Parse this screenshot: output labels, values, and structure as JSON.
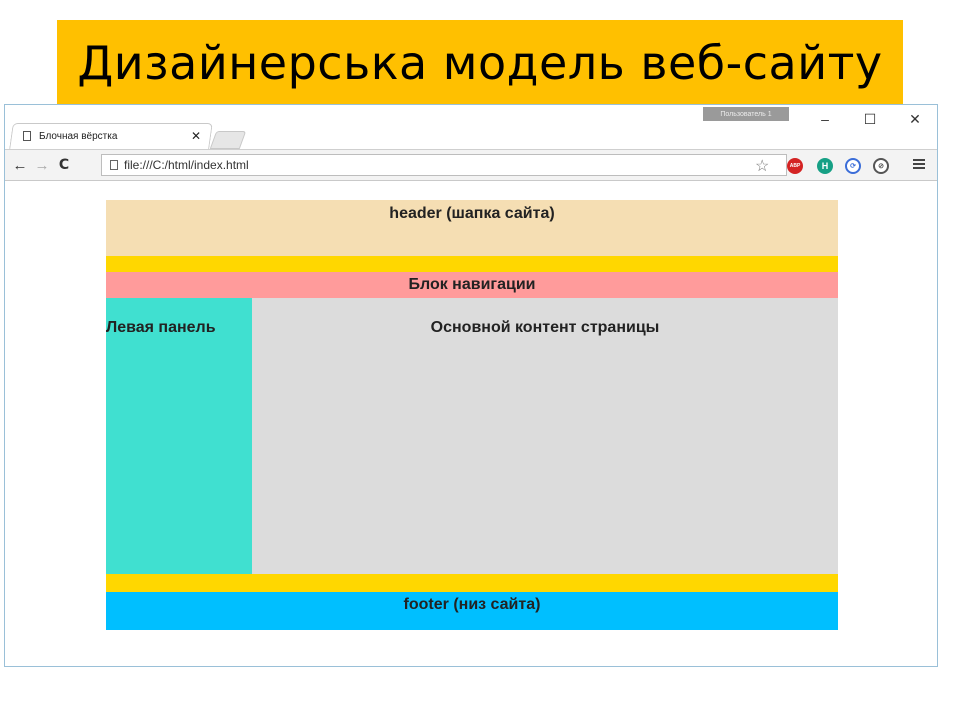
{
  "slide": {
    "title": "Дизайнерська модель веб-сайту"
  },
  "browser": {
    "tab": {
      "title": "Блочная вёрстка",
      "close_glyph": "✕"
    },
    "profile_badge": "Пользователь 1",
    "window_controls": {
      "minimize": "–",
      "maximize": "☐",
      "close": "✕"
    },
    "toolbar": {
      "back_glyph": "←",
      "forward_glyph": "→",
      "reload_glyph": "C",
      "url": "file:///C:/html/index.html",
      "star_glyph": "☆",
      "extensions": [
        {
          "name": "adblock-plus-icon",
          "label": "ABP"
        },
        {
          "name": "h-extension-icon",
          "label": "H"
        },
        {
          "name": "sync-icon",
          "label": "⟳"
        },
        {
          "name": "compass-icon",
          "label": "⊘"
        }
      ]
    }
  },
  "site": {
    "header": "header (шапка сайта)",
    "nav": "Блок навигации",
    "left_panel": "Левая панель",
    "main": "Основной контент страницы",
    "footer": "footer (низ сайта)"
  },
  "colors": {
    "title_bg": "#FFC000",
    "header": "#F5DEB3",
    "gap": "#FFD700",
    "nav": "#FF9B9B",
    "left": "#40E0D0",
    "main": "#DCDCDC",
    "footer": "#00BFFF"
  }
}
